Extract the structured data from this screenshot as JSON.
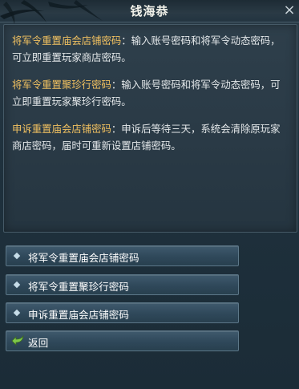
{
  "window": {
    "title": "钱海恭",
    "close_symbol": "×"
  },
  "content": {
    "paragraphs": [
      {
        "heading": "将军令重置庙会店铺密码",
        "text": "：输入账号密码和将军令动态密码，可立即重置玩家商店密码。"
      },
      {
        "heading": "将军令重置聚珍行密码",
        "text": "：输入账号密码和将军令动态密码，可立即重置玩家聚珍行密码。"
      },
      {
        "heading": "申诉重置庙会店铺密码",
        "text": "：申诉后等待三天，系统会清除原玩家商店密码，届时可重新设置店铺密码。"
      }
    ]
  },
  "options": [
    {
      "label": "将军令重置庙会店铺密码",
      "icon": "diamond-bullet-icon"
    },
    {
      "label": "将军令重置聚珍行密码",
      "icon": "diamond-bullet-icon"
    },
    {
      "label": "申诉重置庙会店铺密码",
      "icon": "diamond-bullet-icon"
    },
    {
      "label": "返回",
      "icon": "return-arrow-icon"
    }
  ],
  "colors": {
    "highlight": "#f0c060",
    "body_text": "#e4e8ea",
    "return_icon": "#7fc94a"
  }
}
